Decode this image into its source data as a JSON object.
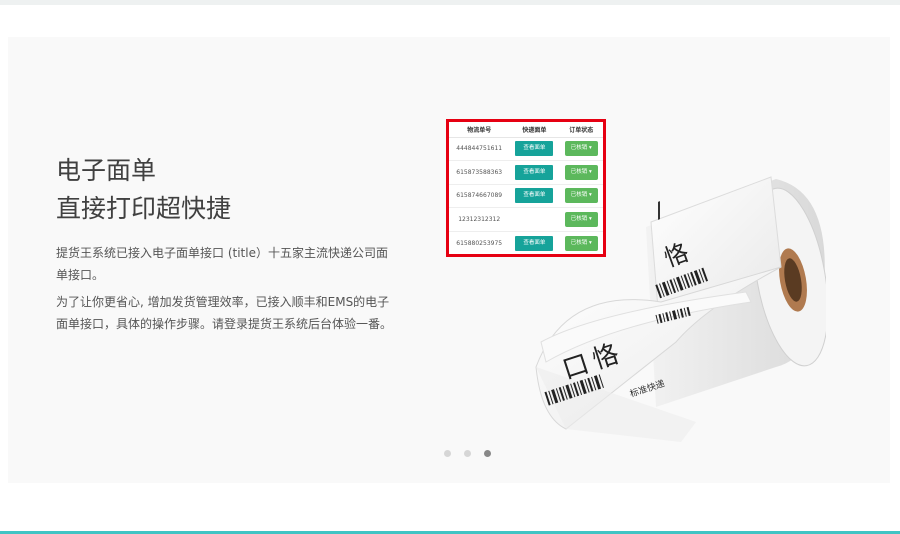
{
  "hero": {
    "headline_line1": "电子面单",
    "headline_line2": "直接打印超快捷",
    "paragraph1": "提货王系统已接入电子面单接口 (title）十五家主流快递公司面单接口。",
    "paragraph2": "为了让你更省心, 增加发货管理效率，已接入顺丰和EMS的电子面单接口，具体的操作步骤。请登录提货王系统后台体验一番。"
  },
  "order_table": {
    "headers": [
      "物流单号",
      "快递面单",
      "订单状态"
    ],
    "rows": [
      {
        "tracking": "444844751611",
        "waybill": "查看面单",
        "status": "已核销 ▾"
      },
      {
        "tracking": "615873588363",
        "waybill": "查看面单",
        "status": "已核销 ▾"
      },
      {
        "tracking": "615874667089",
        "waybill": "查看面单",
        "status": "已核销 ▾"
      },
      {
        "tracking": "12312312312",
        "waybill": "",
        "status": "已核销 ▾"
      },
      {
        "tracking": "615880253975",
        "waybill": "查看面单",
        "status": "已核销 ▾"
      }
    ]
  },
  "label_text": {
    "big_char": "口",
    "big_char2": "恪",
    "tag": "标准快递"
  },
  "carousel": {
    "dot_count": 3,
    "active_index": 2
  },
  "colors": {
    "highlight_border": "#e60012",
    "button_teal": "#16a39a",
    "button_green": "#5cb85c",
    "accent_line": "#40c4c4"
  }
}
